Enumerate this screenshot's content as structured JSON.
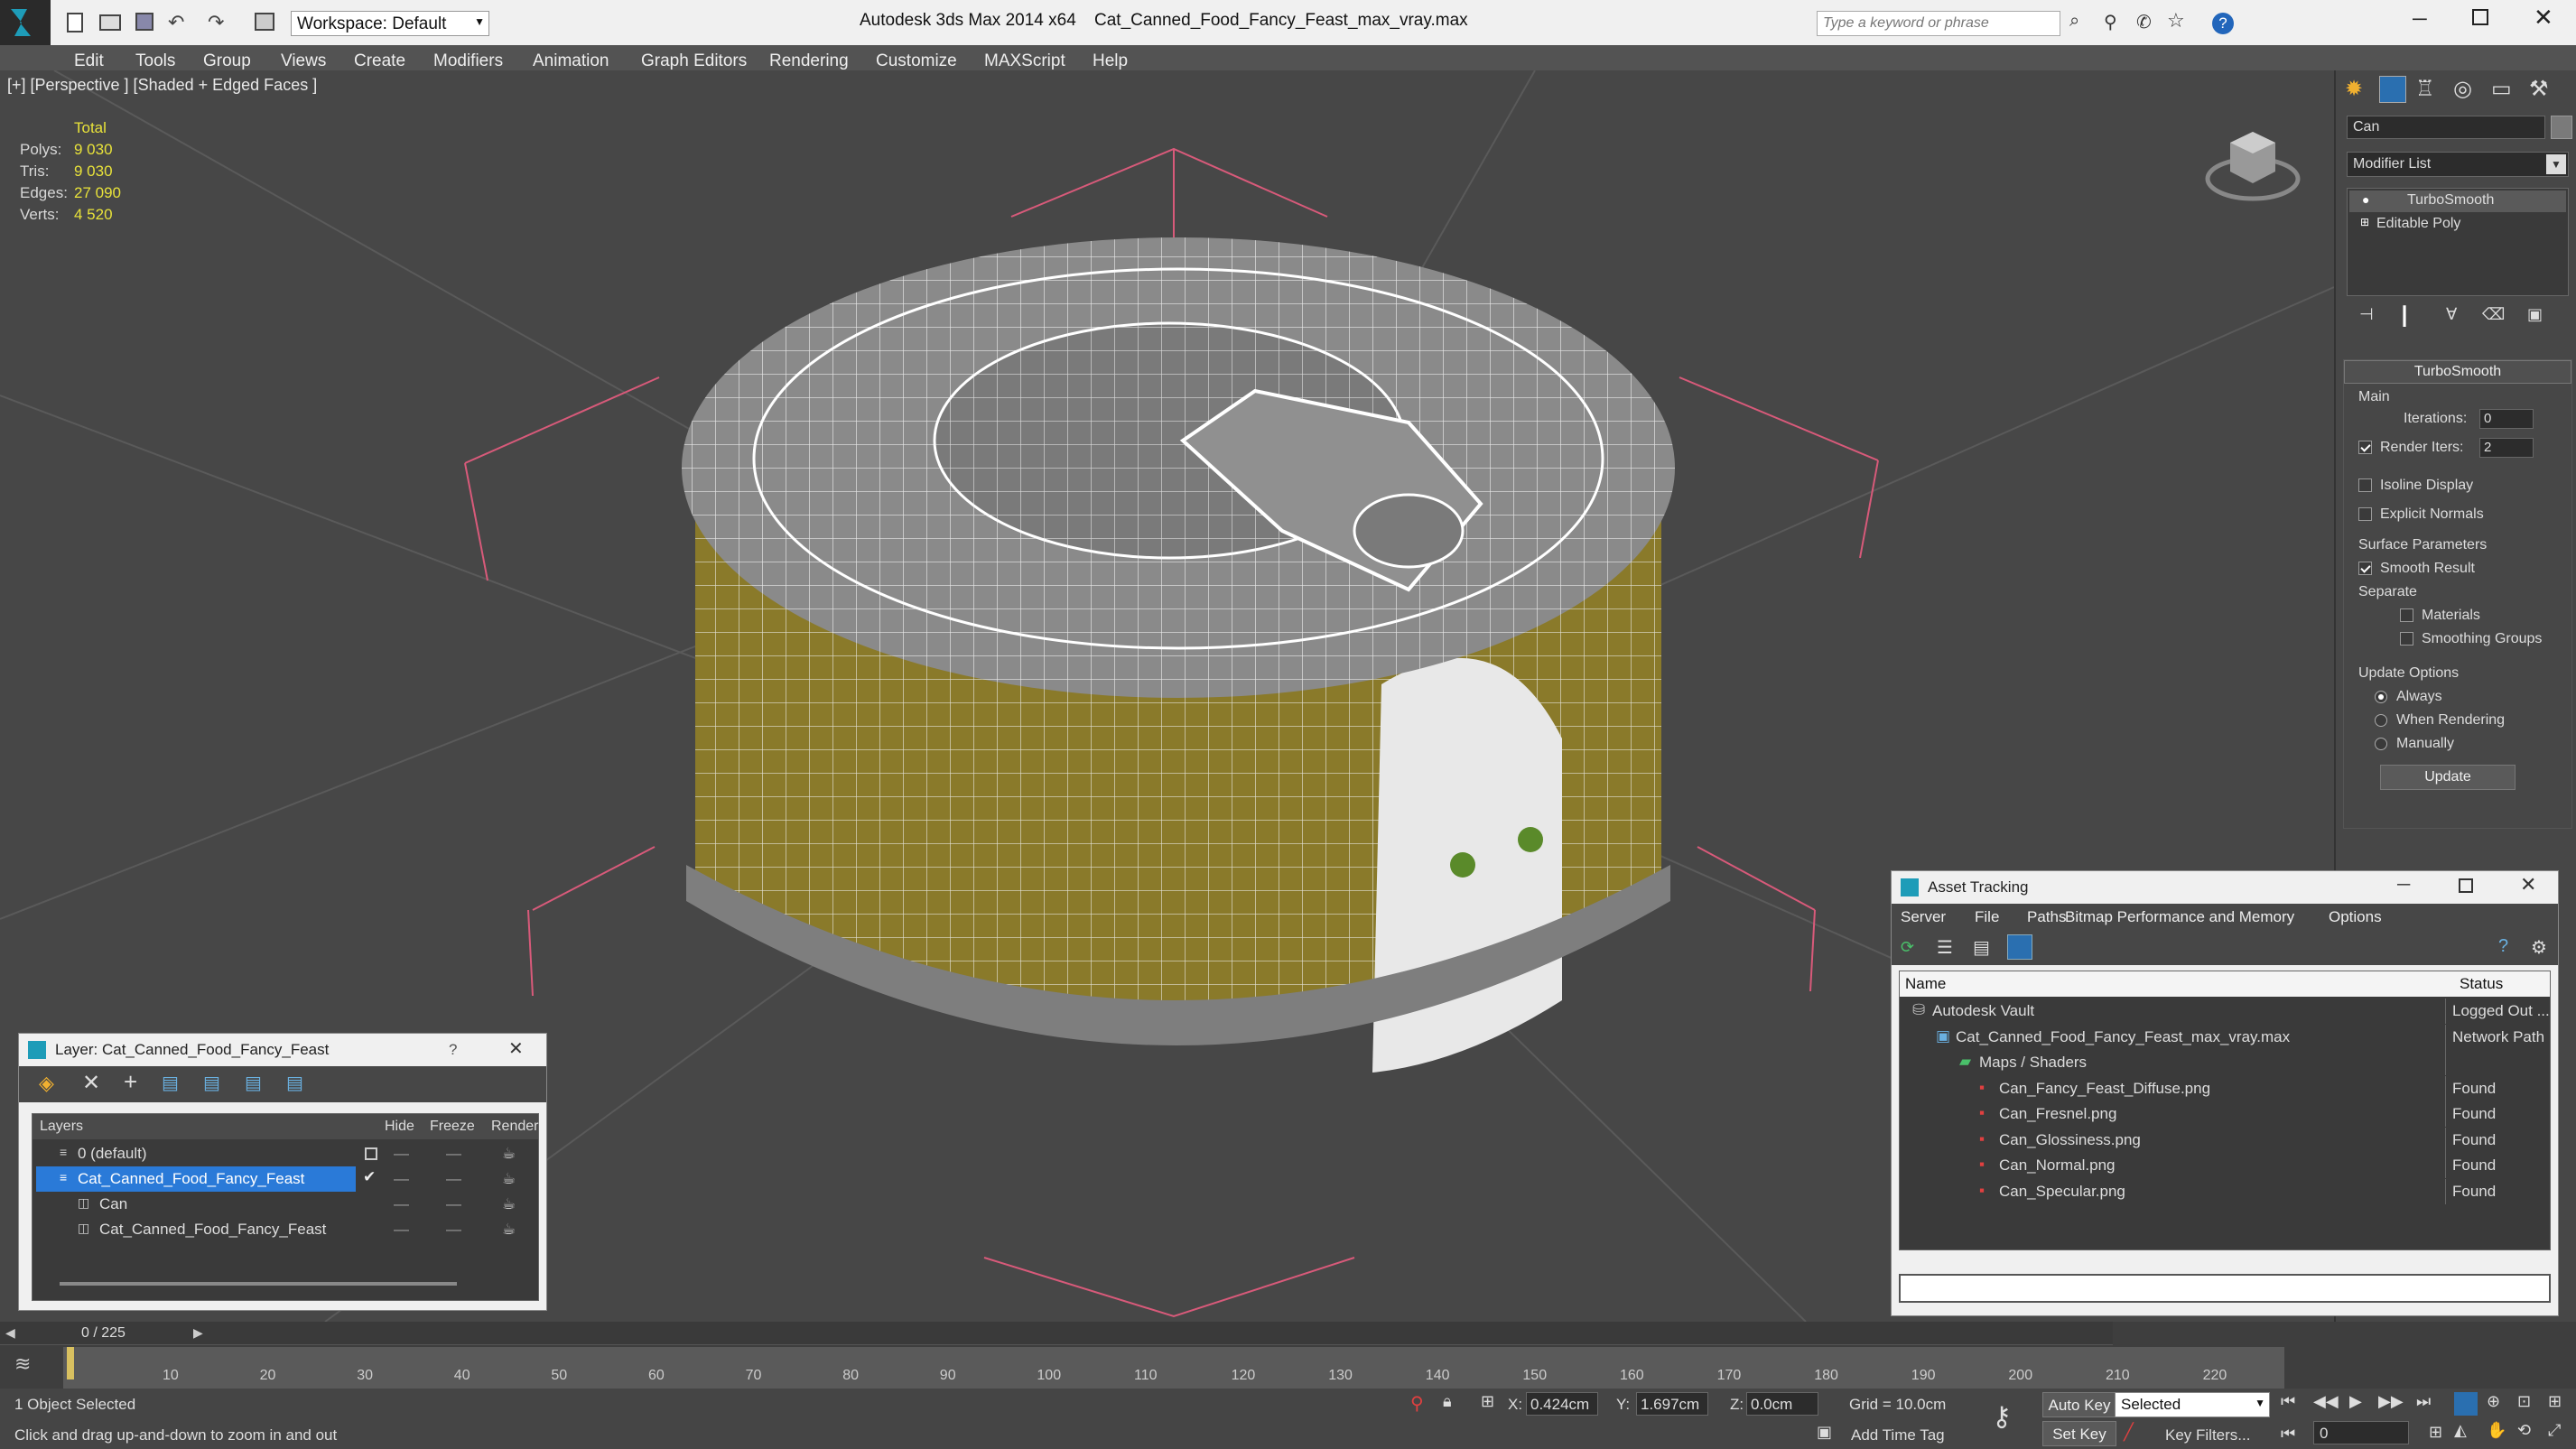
{
  "title_bar": {
    "app_title": "Autodesk 3ds Max  2014 x64",
    "file_title": "Cat_Canned_Food_Fancy_Feast_max_vray.max",
    "workspace_label": "Workspace: Default",
    "search_placeholder": "Type a keyword or phrase"
  },
  "menu": {
    "items": [
      "Edit",
      "Tools",
      "Group",
      "Views",
      "Create",
      "Modifiers",
      "Animation",
      "Graph Editors",
      "Rendering",
      "Customize",
      "MAXScript",
      "Help"
    ]
  },
  "viewport": {
    "label": "[+] [Perspective ] [Shaded + Edged Faces ]",
    "stats": {
      "total_label": "Total",
      "polys_label": "Polys:",
      "polys": "9 030",
      "tris_label": "Tris:",
      "tris": "9 030",
      "edges_label": "Edges:",
      "edges": "27 090",
      "verts_label": "Verts:",
      "verts": "4 520"
    }
  },
  "command_panel": {
    "object_name": "Can",
    "modifier_list": "Modifier List",
    "stack": [
      "TurboSmooth",
      "Editable Poly"
    ],
    "rollout_title": "TurboSmooth",
    "main_label": "Main",
    "iterations_label": "Iterations:",
    "iterations": "0",
    "render_iters_label": "Render Iters:",
    "render_iters": "2",
    "isoline": "Isoline Display",
    "explicit_normals": "Explicit Normals",
    "surface_params": "Surface Parameters",
    "smooth_result": "Smooth Result",
    "separate": "Separate",
    "materials": "Materials",
    "smoothing_groups": "Smoothing Groups",
    "update_options": "Update Options",
    "always": "Always",
    "when_rendering": "When Rendering",
    "manually": "Manually",
    "update_button": "Update"
  },
  "layer_panel": {
    "title": "Layer: Cat_Canned_Food_Fancy_Feast",
    "help": "?",
    "columns": {
      "layers": "Layers",
      "hide": "Hide",
      "freeze": "Freeze",
      "render": "Render"
    },
    "rows": [
      "0 (default)",
      "Cat_Canned_Food_Fancy_Feast",
      "Can",
      "Cat_Canned_Food_Fancy_Feast"
    ]
  },
  "asset_panel": {
    "title": "Asset Tracking",
    "menu": [
      "Server",
      "File",
      "Paths",
      "Bitmap Performance and Memory",
      "Options"
    ],
    "col_name": "Name",
    "col_status": "Status",
    "rows": [
      {
        "name": "Autodesk Vault",
        "status": "Logged Out ..."
      },
      {
        "name": "Cat_Canned_Food_Fancy_Feast_max_vray.max",
        "status": "Network Path"
      },
      {
        "name": "Maps / Shaders",
        "status": ""
      },
      {
        "name": "Can_Fancy_Feast_Diffuse.png",
        "status": "Found"
      },
      {
        "name": "Can_Fresnel.png",
        "status": "Found"
      },
      {
        "name": "Can_Glossiness.png",
        "status": "Found"
      },
      {
        "name": "Can_Normal.png",
        "status": "Found"
      },
      {
        "name": "Can_Specular.png",
        "status": "Found"
      }
    ]
  },
  "timeline": {
    "frame_counter": "0 / 225",
    "ticks": [
      "10",
      "20",
      "30",
      "40",
      "50",
      "60",
      "70",
      "80",
      "90",
      "100",
      "110",
      "120",
      "130",
      "140",
      "150",
      "160",
      "170",
      "180",
      "190",
      "200",
      "210",
      "220"
    ]
  },
  "status_bar": {
    "selected": "1 Object Selected",
    "hint": "Click and drag up-and-down to zoom in and out",
    "x_label": "X:",
    "x": "0.424cm",
    "y_label": "Y:",
    "y": "1.697cm",
    "z_label": "Z:",
    "z": "0.0cm",
    "grid": "Grid = 10.0cm",
    "add_time_tag": "Add Time Tag",
    "auto_key": "Auto Key",
    "set_key": "Set Key",
    "selected_dropdown": "Selected",
    "key_filters": "Key Filters...",
    "frame": "0"
  }
}
